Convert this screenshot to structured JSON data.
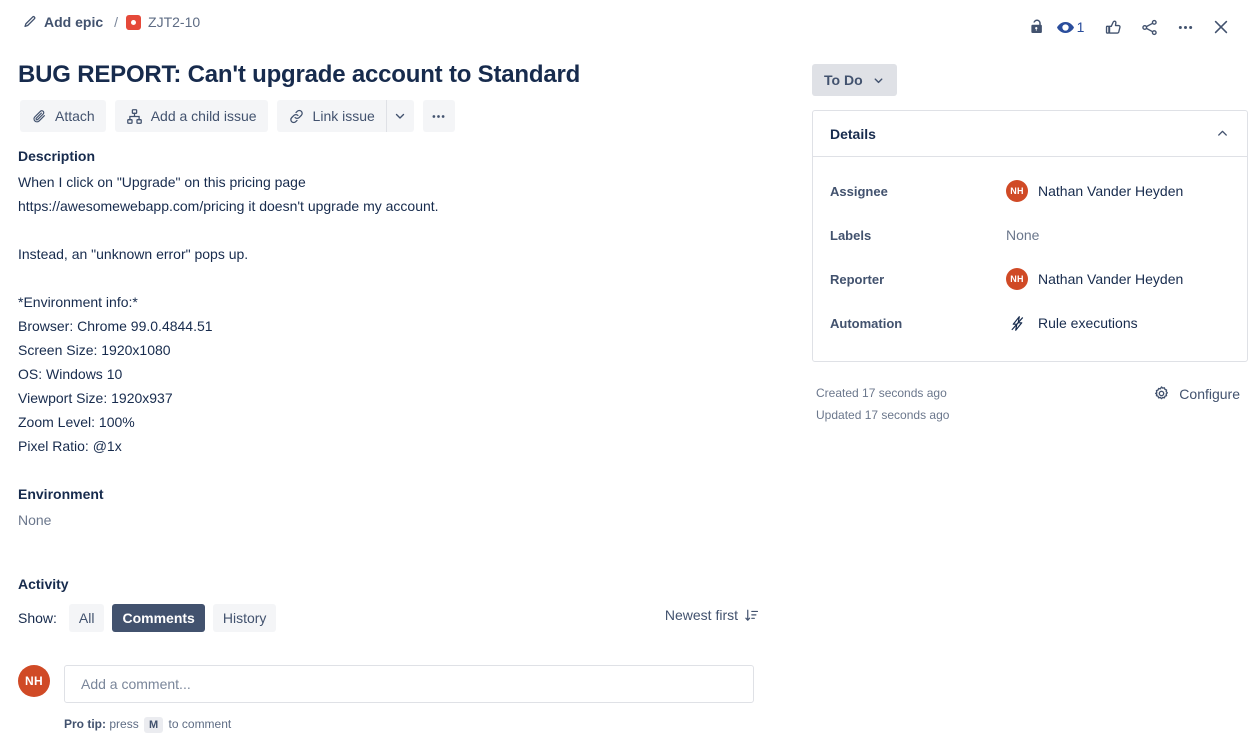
{
  "breadcrumb": {
    "add_epic_label": "Add epic",
    "separator": "/",
    "issue_key": "ZJT2-10",
    "issue_type_icon": "bug-icon",
    "epic_icon": "pencil-icon"
  },
  "topbar": {
    "lock_icon": "unlock-icon",
    "watch_icon": "eye-icon",
    "watch_count": "1",
    "like_icon": "thumbs-up-icon",
    "share_icon": "share-icon",
    "more_icon": "more-horizontal-icon",
    "close_icon": "close-icon",
    "accent_blue": "#2a4d9c"
  },
  "issue": {
    "title": "BUG REPORT: Can't upgrade account to Standard"
  },
  "actions": {
    "attach_label": "Attach",
    "attach_icon": "paperclip-icon",
    "child_issue_label": "Add a child issue",
    "child_issue_icon": "hierarchy-icon",
    "link_issue_label": "Link issue",
    "link_issue_icon": "link-icon",
    "caret_icon": "chevron-down-icon",
    "more_icon": "more-horizontal-icon"
  },
  "description": {
    "heading": "Description",
    "lines": [
      "When I click on \"Upgrade\" on this pricing page",
      "https://awesomewebapp.com/pricing it doesn't upgrade my account.",
      "",
      "Instead, an \"unknown error\" pops up.",
      "",
      "*Environment info:*",
      "Browser: Chrome 99.0.4844.51",
      "Screen Size: 1920x1080",
      "OS: Windows 10",
      "Viewport Size: 1920x937",
      "Zoom Level: 100%",
      "Pixel Ratio: @1x"
    ]
  },
  "environment": {
    "heading": "Environment",
    "value": "None"
  },
  "activity": {
    "heading": "Activity",
    "show_label": "Show:",
    "tabs": [
      {
        "label": "All",
        "selected": false
      },
      {
        "label": "Comments",
        "selected": true
      },
      {
        "label": "History",
        "selected": false
      }
    ],
    "sort_label": "Newest first",
    "sort_icon": "sort-descending-icon"
  },
  "comment": {
    "avatar_initials": "NH",
    "avatar_color": "#D04A26",
    "placeholder": "Add a comment...",
    "value": "",
    "protip_prefix": "Pro tip:",
    "protip_text_before": "press",
    "protip_key": "M",
    "protip_text_after": "to comment"
  },
  "right_panel": {
    "status": {
      "label": "To Do",
      "caret_icon": "chevron-down-icon"
    },
    "details": {
      "title": "Details",
      "collapse_icon": "chevron-up-icon",
      "fields": [
        {
          "label": "Assignee",
          "value": "Nathan Vander Heyden",
          "avatar": "NH",
          "icon": null,
          "muted": false
        },
        {
          "label": "Labels",
          "value": "None",
          "avatar": null,
          "icon": null,
          "muted": true
        },
        {
          "label": "Reporter",
          "value": "Nathan Vander Heyden",
          "avatar": "NH",
          "icon": null,
          "muted": false
        },
        {
          "label": "Automation",
          "value": "Rule executions",
          "avatar": null,
          "icon": "lightning-bolt-icon",
          "muted": false
        }
      ]
    },
    "meta": {
      "created": "Created 17 seconds ago",
      "updated": "Updated 17 seconds ago",
      "configure_label": "Configure",
      "configure_icon": "gear-icon"
    }
  }
}
